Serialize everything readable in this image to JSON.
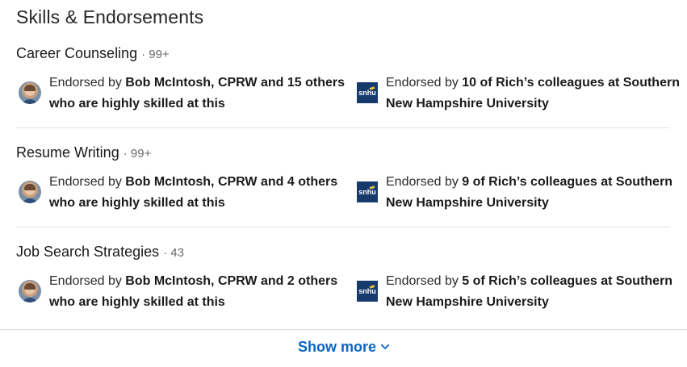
{
  "section": {
    "title": "Skills & Endorsements"
  },
  "skills": [
    {
      "name": "Career Counseling",
      "count": "· 99+",
      "left": {
        "prefix": "Endorsed by ",
        "bold": "Bob McIntosh, CPRW and 15 others",
        "suffix": "who are highly skilled at this"
      },
      "right": {
        "prefix": "Endorsed by ",
        "bold1": "10 of Rich’s colleagues at Southern",
        "bold2": "New Hampshire University"
      }
    },
    {
      "name": "Resume Writing",
      "count": "· 99+",
      "left": {
        "prefix": "Endorsed by ",
        "bold": "Bob McIntosh, CPRW and 4 others",
        "suffix": "who are highly skilled at this"
      },
      "right": {
        "prefix": "Endorsed by ",
        "bold1": "9 of Rich’s colleagues at Southern",
        "bold2": "New Hampshire University"
      }
    },
    {
      "name": "Job Search Strategies",
      "count": "· 43",
      "left": {
        "prefix": "Endorsed by ",
        "bold": "Bob McIntosh, CPRW and 2 others",
        "suffix": "who are highly skilled at this"
      },
      "right": {
        "prefix": "Endorsed by ",
        "bold1": "5 of Rich’s colleagues at Southern",
        "bold2": "New Hampshire University"
      }
    }
  ],
  "logo_text": "snhu",
  "footer": {
    "show_more": "Show more"
  },
  "colors": {
    "accent": "#0a66c2",
    "logo_bg": "#173a6d"
  },
  "icons": {
    "endorser": "avatar",
    "school": "snhu-logo",
    "expand": "chevron-down-icon"
  }
}
